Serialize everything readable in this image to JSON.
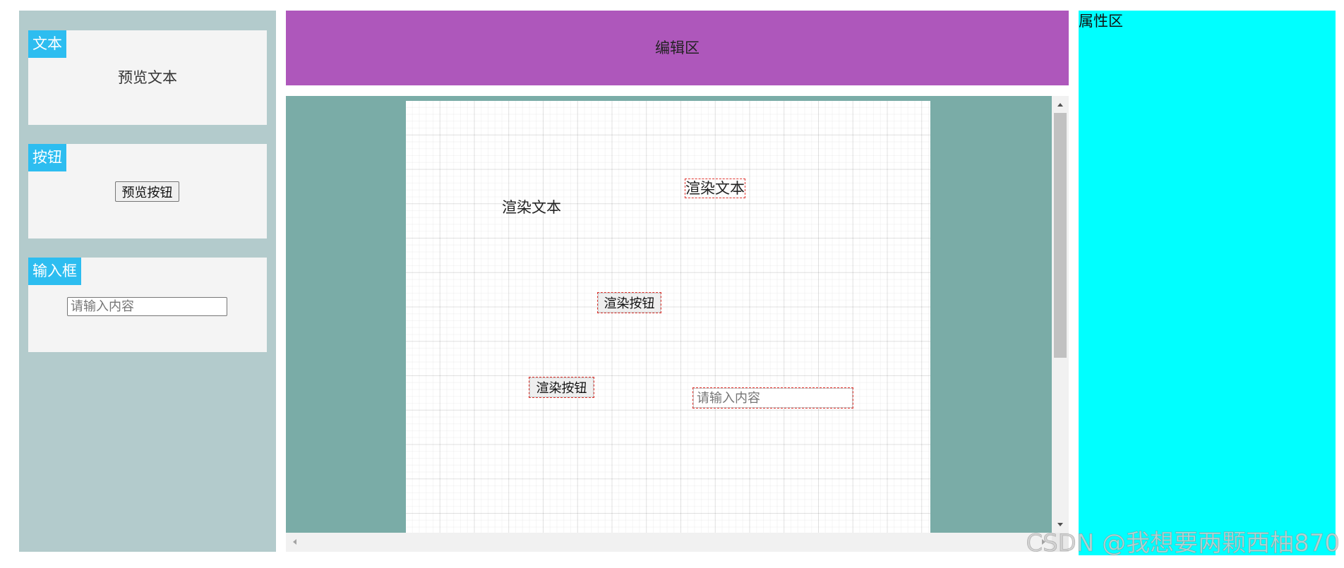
{
  "left_panel": {
    "components": [
      {
        "label": "文本",
        "preview_text": "预览文本"
      },
      {
        "label": "按钮",
        "preview_button": "预览按钮"
      },
      {
        "label": "输入框",
        "preview_placeholder": "请输入内容"
      }
    ]
  },
  "editor": {
    "title": "编辑区",
    "canvas": {
      "text_items": [
        "渲染文本",
        "渲染文本"
      ],
      "button_items": [
        "渲染按钮",
        "渲染按钮"
      ],
      "input_placeholder": "请输入内容",
      "input_value": ""
    }
  },
  "properties": {
    "title": "属性区"
  },
  "watermark": "CSDN @我想要两颗西柚870",
  "icons": {
    "scroll_up": "scroll-up-arrow-icon",
    "scroll_down": "scroll-down-arrow-icon",
    "scroll_left": "scroll-left-arrow-icon",
    "scroll_right": "scroll-right-arrow-icon"
  },
  "colors": {
    "left_panel": "#b3cbcc",
    "card": "#f4f4f4",
    "label": "#2dbdf0",
    "editor_header": "#ae57bb",
    "canvas_area": "#7aaca7",
    "canvas": "#ffffff",
    "properties_panel": "#00ffff",
    "outline": "#e0352f"
  }
}
